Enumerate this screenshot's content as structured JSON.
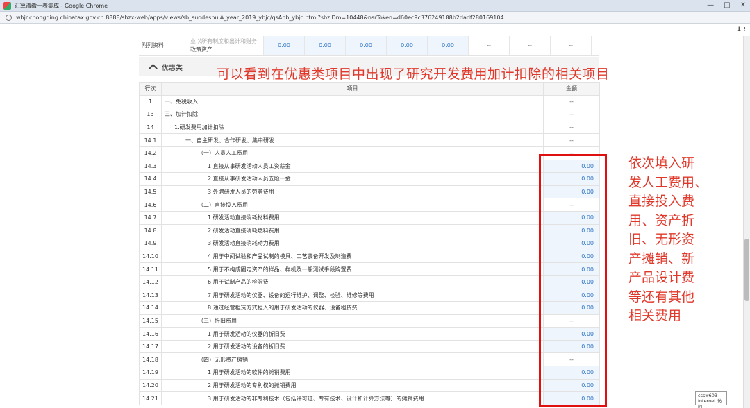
{
  "window": {
    "title": "汇算清缴一表集成 - Google Chrome",
    "url": "wbjr.chongqing.chinatax.gov.cn:8888/sbzx-web/apps/views/sb_suodeshuiA_year_2019_ybjc/qsAnb_ybjc.html?sbzlDm=10448&nsrToken=d60ec9c376249188b2dadf280169104",
    "controls": [
      "—",
      "□",
      "✕"
    ],
    "toolstrip_icons": "⬇ ⁝"
  },
  "top_row": {
    "label": "附列资料",
    "sub_line1": "业以所有制度和出计和财务",
    "sub_line2": "政策资产",
    "values": [
      "0.00",
      "0.00",
      "0.00",
      "0.00",
      "0.00"
    ],
    "dashes": [
      "--",
      "--",
      "--"
    ]
  },
  "section": {
    "title": "优惠类",
    "header_no": "行次",
    "header_item": "项目",
    "header_amount": "金额"
  },
  "rows": [
    {
      "no": "1",
      "item": "一、免税收入",
      "amount": "--",
      "indent": 0
    },
    {
      "no": "13",
      "item": "三、加计扣除",
      "amount": "--",
      "indent": 0
    },
    {
      "no": "14",
      "item": "1.研发费用加计扣除",
      "amount": "--",
      "indent": 1
    },
    {
      "no": "14.1",
      "item": "一、自主研发、合作研发、集中研发",
      "amount": "--",
      "indent": 2
    },
    {
      "no": "14.2",
      "item": "（一）人员人工费用",
      "amount": "--",
      "indent": 3
    },
    {
      "no": "14.3",
      "item": "1.直接从事研发活动人员工资薪金",
      "amount": "0.00",
      "indent": 4
    },
    {
      "no": "14.4",
      "item": "2.直接从事研发活动人员五险一金",
      "amount": "0.00",
      "indent": 4
    },
    {
      "no": "14.5",
      "item": "3.外聘研发人员的劳务费用",
      "amount": "0.00",
      "indent": 4
    },
    {
      "no": "14.6",
      "item": "（二）直接投入费用",
      "amount": "--",
      "indent": 3
    },
    {
      "no": "14.7",
      "item": "1.研发活动直接消耗材料费用",
      "amount": "0.00",
      "indent": 4
    },
    {
      "no": "14.8",
      "item": "2.研发活动直接消耗燃料费用",
      "amount": "0.00",
      "indent": 4
    },
    {
      "no": "14.9",
      "item": "3.研发活动直接消耗动力费用",
      "amount": "0.00",
      "indent": 4
    },
    {
      "no": "14.10",
      "item": "4.用于中间试验和产品试制的模具、工艺装备开发及制造费",
      "amount": "0.00",
      "indent": 4
    },
    {
      "no": "14.11",
      "item": "5.用于不构成固定资产的样品、样机及一般测试手段购置费",
      "amount": "0.00",
      "indent": 4
    },
    {
      "no": "14.12",
      "item": "6.用于试制产品的检验费",
      "amount": "0.00",
      "indent": 4
    },
    {
      "no": "14.13",
      "item": "7.用于研发活动的仪器、设备的运行维护、调整、检验、维修等费用",
      "amount": "0.00",
      "indent": 4
    },
    {
      "no": "14.14",
      "item": "8.通过经营租赁方式租入的用于研发活动的仪器、设备租赁费",
      "amount": "0.00",
      "indent": 4
    },
    {
      "no": "14.15",
      "item": "（三）折旧费用",
      "amount": "--",
      "indent": 3
    },
    {
      "no": "14.16",
      "item": "1.用于研发活动的仪器的折旧费",
      "amount": "0.00",
      "indent": 4
    },
    {
      "no": "14.17",
      "item": "2.用于研发活动的设备的折旧费",
      "amount": "0.00",
      "indent": 4
    },
    {
      "no": "14.18",
      "item": "（四）无形资产摊销",
      "amount": "--",
      "indent": 3
    },
    {
      "no": "14.19",
      "item": "1.用于研发活动的软件的摊销费用",
      "amount": "0.00",
      "indent": 4
    },
    {
      "no": "14.20",
      "item": "2.用于研发活动的专利权的摊销费用",
      "amount": "0.00",
      "indent": 4
    },
    {
      "no": "14.21",
      "item": "3.用于研发活动的非专利技术（包括许可证、专有技术、设计和计算方法等）的摊销费用",
      "amount": "0.00",
      "indent": 4
    }
  ],
  "annotations": {
    "top": "可以看到在优惠类项目中出现了研究开发费用加计扣除的相关项目",
    "side_lines": [
      "依次填入研",
      "发人工费用、",
      "直接投入费",
      "用、资产折",
      "旧、无形资",
      "产摊销、新",
      "产品设计费",
      "等还有其他",
      "相关费用"
    ]
  },
  "status_tag": {
    "line1": "cssw603",
    "line2": "Internet 访问"
  },
  "colors": {
    "annotation_red": "#e0392b",
    "box_red": "#e01010",
    "value_blue": "#2c72c4"
  }
}
